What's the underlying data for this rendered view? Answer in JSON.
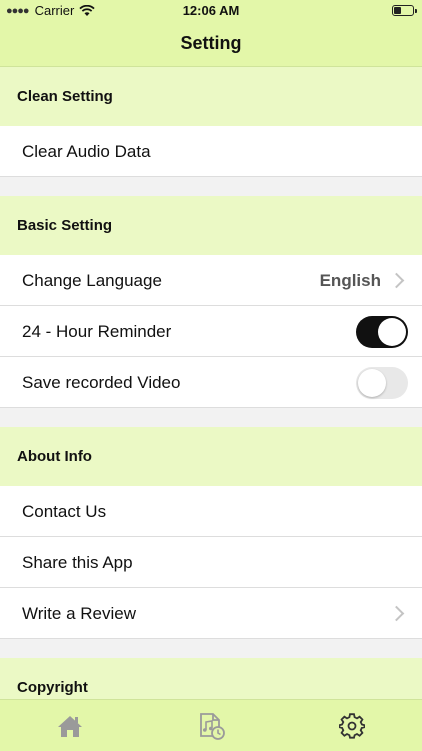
{
  "status": {
    "carrier": "Carrier",
    "time": "12:06 AM"
  },
  "nav": {
    "title": "Setting"
  },
  "sections": {
    "clean": {
      "title": "Clean Setting",
      "clear_audio": "Clear Audio Data"
    },
    "basic": {
      "title": "Basic Setting",
      "language_label": "Change Language",
      "language_value": "English",
      "reminder_label": "24 - Hour Reminder",
      "reminder_on": true,
      "save_video_label": "Save recorded Video",
      "save_video_on": false
    },
    "about": {
      "title": "About Info",
      "contact": "Contact Us",
      "share": "Share this App",
      "review": "Write a Review"
    },
    "copyright": {
      "title": "Copyright"
    }
  },
  "tabs": [
    {
      "name": "home",
      "icon": "home-icon"
    },
    {
      "name": "recordings",
      "icon": "audio-file-icon"
    },
    {
      "name": "settings",
      "icon": "gear-icon"
    }
  ],
  "colors": {
    "accent": "#e3f7a9",
    "section_bg": "#ebf9c5",
    "toggle_on": "#111111"
  }
}
